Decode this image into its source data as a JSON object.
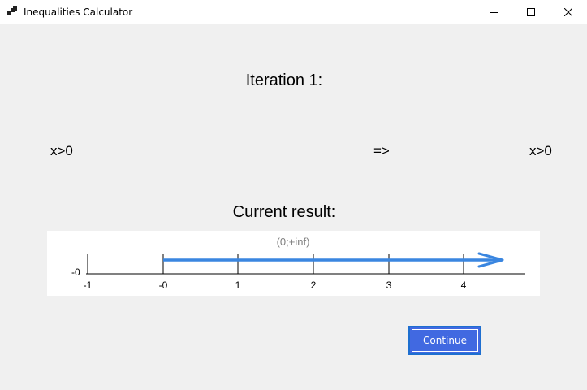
{
  "window": {
    "title": "Inequalities Calculator"
  },
  "iteration_label": "Iteration 1:",
  "step": {
    "left": "x>0",
    "arrow": "=>",
    "right": "x>0"
  },
  "current_result_label": "Current result:",
  "number_line": {
    "interval_label": "(0;+inf)",
    "y_label": "-0",
    "ticks": [
      "-1",
      "-0",
      "1",
      "2",
      "3",
      "4"
    ],
    "highlight_color": "#3a86e0"
  },
  "continue_label": "Continue"
}
